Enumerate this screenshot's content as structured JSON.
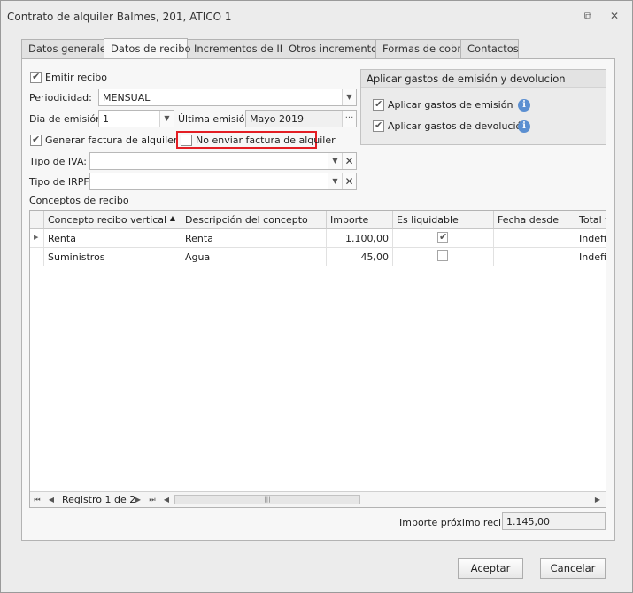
{
  "window": {
    "title": "Contrato de alquiler Balmes, 201, ATICO 1",
    "restore_glyph": "⧉",
    "close_glyph": "✕"
  },
  "tabs": [
    {
      "label": "Datos generales"
    },
    {
      "label": "Datos de recibo"
    },
    {
      "label": "Incrementos de IPC"
    },
    {
      "label": "Otros incrementos"
    },
    {
      "label": "Formas de cobro"
    },
    {
      "label": "Contactos"
    }
  ],
  "active_tab": "Datos de recibo",
  "form": {
    "emitir_recibo_label": "Emitir recibo",
    "emitir_recibo_checked": true,
    "periodicidad_label": "Periodicidad:",
    "periodicidad_value": "MENSUAL",
    "dia_emision_label": "Dia de emisión:",
    "dia_emision_value": "1",
    "ultima_emision_label": "Última emisión:",
    "ultima_emision_value": "Mayo 2019",
    "ellipsis": "···",
    "generar_factura_label": "Generar factura de alquiler",
    "generar_factura_checked": true,
    "no_enviar_factura_label": "No enviar factura de alquiler",
    "no_enviar_factura_checked": false,
    "tipo_iva_label": "Tipo de IVA:",
    "tipo_iva_value": "",
    "tipo_irpf_label": "Tipo de IRPF:",
    "tipo_irpf_value": "",
    "conceptos_label": "Conceptos de recibo"
  },
  "gastos_group": {
    "title": "Aplicar gastos de emisión y devolucion",
    "emision_label": "Aplicar gastos de emisión",
    "emision_checked": true,
    "devolucion_label": "Aplicar gastos de devolución",
    "devolucion_checked": true,
    "info_glyph": "i"
  },
  "grid": {
    "columns": [
      "Concepto recibo vertical",
      "Descripción del concepto",
      "Importe",
      "Es liquidable",
      "Fecha desde",
      "Total v"
    ],
    "sort_glyph": "▲",
    "rows": [
      {
        "concepto": "Renta",
        "descripcion": "Renta",
        "importe": "1.100,00",
        "liquidable": true,
        "fecha_desde": "",
        "total": "Indefi"
      },
      {
        "concepto": "Suministros",
        "descripcion": "Agua",
        "importe": "45,00",
        "liquidable": false,
        "fecha_desde": "",
        "total": "Indefi"
      }
    ],
    "navigator_text": "Registro 1 de 2",
    "importe_proximo_label": "Importe próximo recibo",
    "importe_proximo_value": "1.145,00"
  },
  "buttons": {
    "accept": "Aceptar",
    "cancel": "Cancelar"
  }
}
